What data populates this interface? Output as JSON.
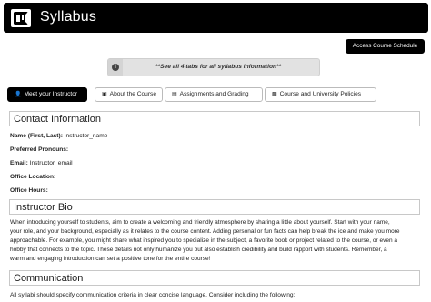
{
  "header": {
    "title": "Syllabus",
    "logo": "cu-logo"
  },
  "toolbar": {
    "access_schedule_label": "Access Course Schedule"
  },
  "notice": {
    "icon": "info-icon",
    "text": "**See all 4 tabs for all syllabus information**"
  },
  "tabs": [
    {
      "label": "Meet your Instructor",
      "icon": "user-icon",
      "active": true
    },
    {
      "label": "About the Course",
      "icon": "book-icon",
      "active": false
    },
    {
      "label": "Assignments and Grading",
      "icon": "document-icon",
      "active": false
    },
    {
      "label": "Course and University Policies",
      "icon": "open-book-icon",
      "active": false
    }
  ],
  "contact": {
    "heading": "Contact Information",
    "name_label": "Name (First, Last):",
    "name_value": " Instructor_name",
    "pronouns_label": "Preferred Pronouns:",
    "email_label": "Email:",
    "email_value": " Instructor_email",
    "office_location_label": "Office Location:",
    "office_hours_label": "Office Hours:"
  },
  "bio": {
    "heading": "Instructor Bio",
    "lines": [
      "When introducing yourself to students, aim to create a welcoming and friendly atmosphere by sharing a little about yourself. Start with your name,",
      "your role, and your background, especially as it relates to the course content. Adding personal or fun facts can help break the ice and make you more",
      "approachable. For example, you might share what inspired you to specialize in the subject, a favorite book or project related to the course, or even a",
      "hobby that connects to the topic. These details not only humanize you but also establish credibility and build rapport with students. Remember, a",
      "warm and engaging introduction can set a positive tone for the entire course!"
    ]
  },
  "communication": {
    "heading": "Communication",
    "text": "All syllabi should specify communication criteria in clear concise language. Consider including the following:"
  }
}
